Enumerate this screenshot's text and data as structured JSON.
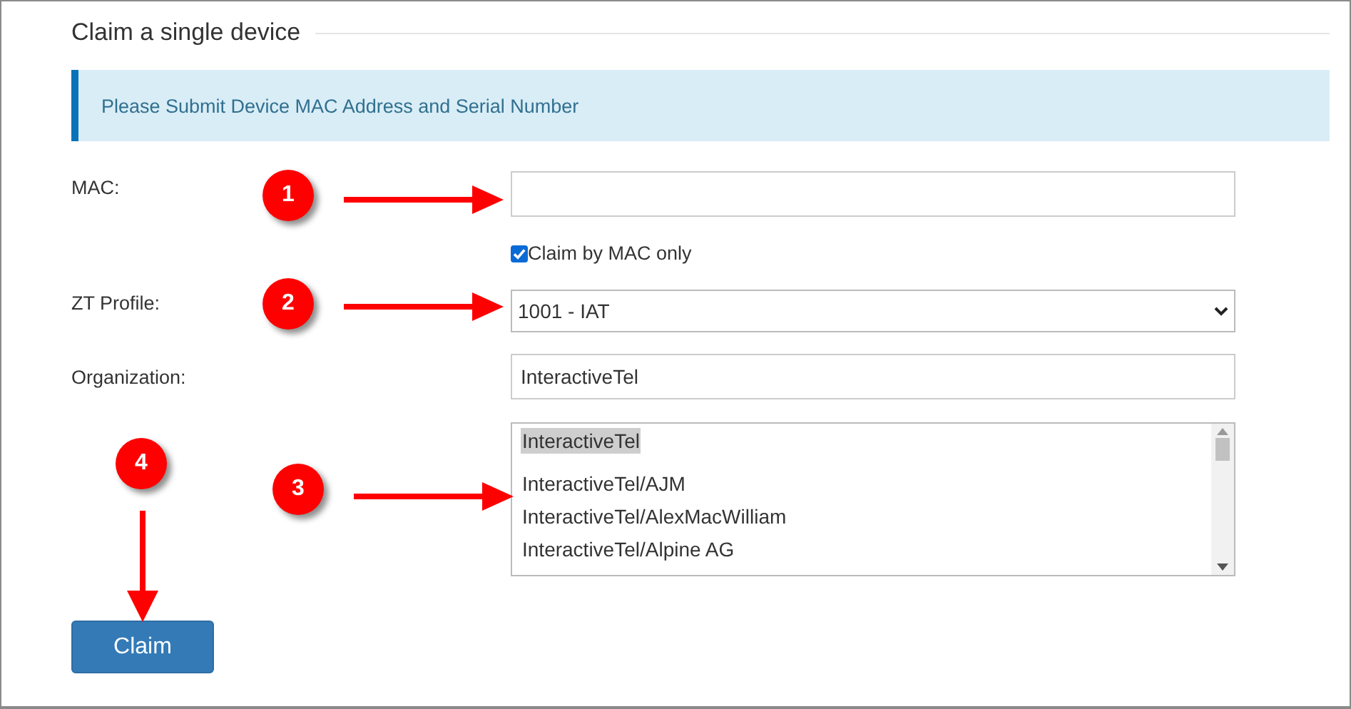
{
  "title": "Claim a single device",
  "alert": "Please Submit Device MAC Address and Serial Number",
  "fields": [
    {
      "kind": "input",
      "label": "MAC:"
    },
    {
      "kind": "checkbox",
      "label": "Claim by MAC only",
      "checked": true
    },
    {
      "kind": "select",
      "label": "ZT Profile:",
      "value": "1001 - IAT"
    },
    {
      "kind": "input",
      "label": "Organization:",
      "value": "InteractiveTel"
    },
    {
      "kind": "listbox",
      "options": [
        {
          "label": "InteractiveTel",
          "selected": true
        },
        {
          "label": "InteractiveTel/AJM",
          "selected": false
        },
        {
          "label": "InteractiveTel/AlexMacWilliam",
          "selected": false
        },
        {
          "label": "InteractiveTel/Alpine AG",
          "selected": false
        }
      ]
    }
  ],
  "button": "Claim",
  "annotations": [
    {
      "number": "1",
      "kind": "right"
    },
    {
      "number": "2",
      "kind": "right"
    },
    {
      "number": "3",
      "kind": "right"
    },
    {
      "number": "4",
      "kind": "down"
    }
  ]
}
